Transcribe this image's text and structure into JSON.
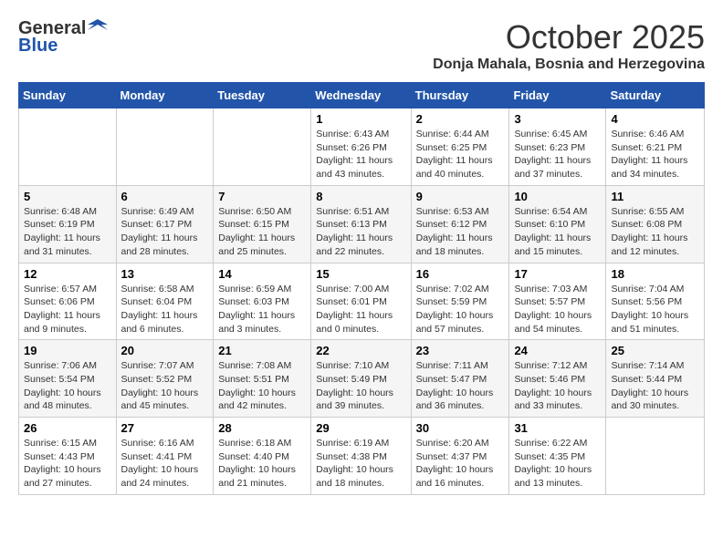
{
  "header": {
    "logo_general": "General",
    "logo_blue": "Blue",
    "month_year": "October 2025",
    "location": "Donja Mahala, Bosnia and Herzegovina"
  },
  "weekdays": [
    "Sunday",
    "Monday",
    "Tuesday",
    "Wednesday",
    "Thursday",
    "Friday",
    "Saturday"
  ],
  "weeks": [
    [
      {
        "day": "",
        "info": ""
      },
      {
        "day": "",
        "info": ""
      },
      {
        "day": "",
        "info": ""
      },
      {
        "day": "1",
        "info": "Sunrise: 6:43 AM\nSunset: 6:26 PM\nDaylight: 11 hours and 43 minutes."
      },
      {
        "day": "2",
        "info": "Sunrise: 6:44 AM\nSunset: 6:25 PM\nDaylight: 11 hours and 40 minutes."
      },
      {
        "day": "3",
        "info": "Sunrise: 6:45 AM\nSunset: 6:23 PM\nDaylight: 11 hours and 37 minutes."
      },
      {
        "day": "4",
        "info": "Sunrise: 6:46 AM\nSunset: 6:21 PM\nDaylight: 11 hours and 34 minutes."
      }
    ],
    [
      {
        "day": "5",
        "info": "Sunrise: 6:48 AM\nSunset: 6:19 PM\nDaylight: 11 hours and 31 minutes."
      },
      {
        "day": "6",
        "info": "Sunrise: 6:49 AM\nSunset: 6:17 PM\nDaylight: 11 hours and 28 minutes."
      },
      {
        "day": "7",
        "info": "Sunrise: 6:50 AM\nSunset: 6:15 PM\nDaylight: 11 hours and 25 minutes."
      },
      {
        "day": "8",
        "info": "Sunrise: 6:51 AM\nSunset: 6:13 PM\nDaylight: 11 hours and 22 minutes."
      },
      {
        "day": "9",
        "info": "Sunrise: 6:53 AM\nSunset: 6:12 PM\nDaylight: 11 hours and 18 minutes."
      },
      {
        "day": "10",
        "info": "Sunrise: 6:54 AM\nSunset: 6:10 PM\nDaylight: 11 hours and 15 minutes."
      },
      {
        "day": "11",
        "info": "Sunrise: 6:55 AM\nSunset: 6:08 PM\nDaylight: 11 hours and 12 minutes."
      }
    ],
    [
      {
        "day": "12",
        "info": "Sunrise: 6:57 AM\nSunset: 6:06 PM\nDaylight: 11 hours and 9 minutes."
      },
      {
        "day": "13",
        "info": "Sunrise: 6:58 AM\nSunset: 6:04 PM\nDaylight: 11 hours and 6 minutes."
      },
      {
        "day": "14",
        "info": "Sunrise: 6:59 AM\nSunset: 6:03 PM\nDaylight: 11 hours and 3 minutes."
      },
      {
        "day": "15",
        "info": "Sunrise: 7:00 AM\nSunset: 6:01 PM\nDaylight: 11 hours and 0 minutes."
      },
      {
        "day": "16",
        "info": "Sunrise: 7:02 AM\nSunset: 5:59 PM\nDaylight: 10 hours and 57 minutes."
      },
      {
        "day": "17",
        "info": "Sunrise: 7:03 AM\nSunset: 5:57 PM\nDaylight: 10 hours and 54 minutes."
      },
      {
        "day": "18",
        "info": "Sunrise: 7:04 AM\nSunset: 5:56 PM\nDaylight: 10 hours and 51 minutes."
      }
    ],
    [
      {
        "day": "19",
        "info": "Sunrise: 7:06 AM\nSunset: 5:54 PM\nDaylight: 10 hours and 48 minutes."
      },
      {
        "day": "20",
        "info": "Sunrise: 7:07 AM\nSunset: 5:52 PM\nDaylight: 10 hours and 45 minutes."
      },
      {
        "day": "21",
        "info": "Sunrise: 7:08 AM\nSunset: 5:51 PM\nDaylight: 10 hours and 42 minutes."
      },
      {
        "day": "22",
        "info": "Sunrise: 7:10 AM\nSunset: 5:49 PM\nDaylight: 10 hours and 39 minutes."
      },
      {
        "day": "23",
        "info": "Sunrise: 7:11 AM\nSunset: 5:47 PM\nDaylight: 10 hours and 36 minutes."
      },
      {
        "day": "24",
        "info": "Sunrise: 7:12 AM\nSunset: 5:46 PM\nDaylight: 10 hours and 33 minutes."
      },
      {
        "day": "25",
        "info": "Sunrise: 7:14 AM\nSunset: 5:44 PM\nDaylight: 10 hours and 30 minutes."
      }
    ],
    [
      {
        "day": "26",
        "info": "Sunrise: 6:15 AM\nSunset: 4:43 PM\nDaylight: 10 hours and 27 minutes."
      },
      {
        "day": "27",
        "info": "Sunrise: 6:16 AM\nSunset: 4:41 PM\nDaylight: 10 hours and 24 minutes."
      },
      {
        "day": "28",
        "info": "Sunrise: 6:18 AM\nSunset: 4:40 PM\nDaylight: 10 hours and 21 minutes."
      },
      {
        "day": "29",
        "info": "Sunrise: 6:19 AM\nSunset: 4:38 PM\nDaylight: 10 hours and 18 minutes."
      },
      {
        "day": "30",
        "info": "Sunrise: 6:20 AM\nSunset: 4:37 PM\nDaylight: 10 hours and 16 minutes."
      },
      {
        "day": "31",
        "info": "Sunrise: 6:22 AM\nSunset: 4:35 PM\nDaylight: 10 hours and 13 minutes."
      },
      {
        "day": "",
        "info": ""
      }
    ]
  ]
}
